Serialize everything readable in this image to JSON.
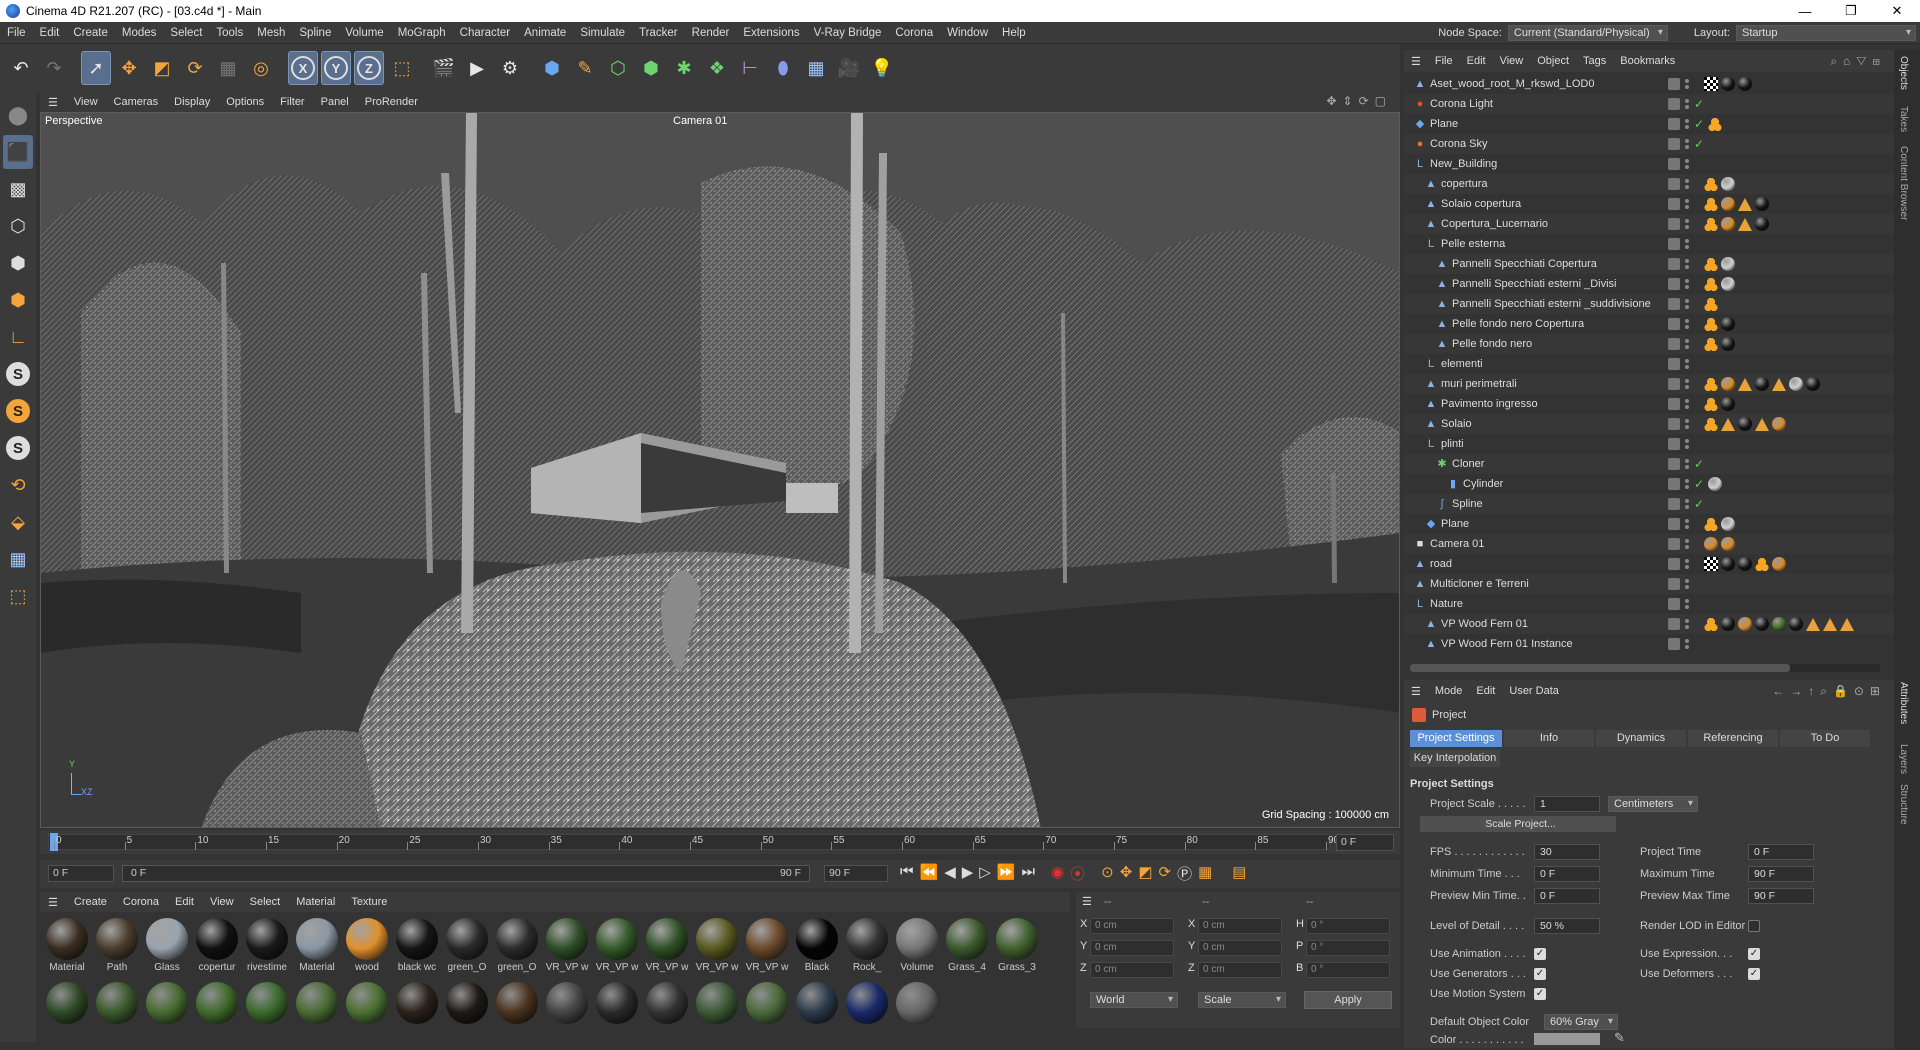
{
  "window": {
    "title": "Cinema 4D R21.207 (RC) - [03.c4d *] - Main",
    "controls": [
      "—",
      "❐",
      "✕"
    ]
  },
  "menubar": {
    "items": [
      "File",
      "Edit",
      "Create",
      "Modes",
      "Select",
      "Tools",
      "Mesh",
      "Spline",
      "Volume",
      "MoGraph",
      "Character",
      "Animate",
      "Simulate",
      "Tracker",
      "Render",
      "Extensions",
      "V-Ray Bridge",
      "Corona",
      "Window",
      "Help"
    ],
    "node_space_label": "Node Space:",
    "node_space_value": "Current (Standard/Physical)",
    "layout_label": "Layout:",
    "layout_value": "Startup"
  },
  "viewport": {
    "menu": [
      "View",
      "Cameras",
      "Display",
      "Options",
      "Filter",
      "Panel",
      "ProRender"
    ],
    "view_name": "Perspective",
    "camera_name": "Camera 01",
    "grid_spacing": "Grid Spacing : 100000 cm",
    "axis_y": "Y",
    "axis_xz": "XZ"
  },
  "timeline": {
    "ticks": [
      "0",
      "5",
      "10",
      "15",
      "20",
      "25",
      "30",
      "35",
      "40",
      "45",
      "50",
      "55",
      "60",
      "65",
      "70",
      "75",
      "80",
      "85",
      "90"
    ],
    "current_frame_field": "0 F",
    "start_field": "0 F",
    "range_start": "0 F",
    "range_end": "90 F",
    "end_field": "90 F"
  },
  "materials": {
    "menu": [
      "Create",
      "Corona",
      "Edit",
      "View",
      "Select",
      "Material",
      "Texture"
    ],
    "row1": [
      {
        "name": "Material",
        "color": "#3a2e22"
      },
      {
        "name": "Path",
        "color": "#4a3d2c"
      },
      {
        "name": "Glass",
        "color": "#9aa4ad"
      },
      {
        "name": "copertur",
        "color": "#111111"
      },
      {
        "name": "rivestime",
        "color": "#1a1a1a"
      },
      {
        "name": "Material",
        "color": "#8c96a3"
      },
      {
        "name": "wood",
        "color": "#e0902e"
      },
      {
        "name": "black wc",
        "color": "#151515"
      },
      {
        "name": "green_O",
        "color": "#2a2a2a"
      },
      {
        "name": "green_O",
        "color": "#2c2c2c"
      },
      {
        "name": "VR_VP w",
        "color": "#2e4f26"
      },
      {
        "name": "VR_VP w",
        "color": "#345a2a"
      },
      {
        "name": "VR_VP w",
        "color": "#2f5226"
      },
      {
        "name": "VR_VP w",
        "color": "#5a5a22"
      },
      {
        "name": "VR_VP w",
        "color": "#6b4a2a"
      },
      {
        "name": "Black",
        "color": "#050505"
      },
      {
        "name": "Rock_",
        "color": "#333333"
      },
      {
        "name": "Volume",
        "color": "#777777"
      },
      {
        "name": "Grass_4",
        "color": "#3c5a2c"
      },
      {
        "name": "Grass_3",
        "color": "#40622e"
      }
    ],
    "row2": [
      "#2e4a26",
      "#3a5a2c",
      "#476b30",
      "#3f6a2c",
      "#3b6a2e",
      "#486b33",
      "#4b7032",
      "#2a221a",
      "#1e1a16",
      "#4a3320",
      "#444444",
      "#2a2a2a",
      "#333333",
      "#3c5a34",
      "#4a6a3a",
      "#2a3a4a",
      "#1a2a6a",
      "#666666"
    ]
  },
  "coords": {
    "header": [
      "--",
      "--",
      "--"
    ],
    "rows": [
      {
        "a1": "X",
        "v1": "0 cm",
        "a2": "X",
        "v2": "0 cm",
        "a3": "H",
        "v3": "0 °"
      },
      {
        "a1": "Y",
        "v1": "0 cm",
        "a2": "Y",
        "v2": "0 cm",
        "a3": "P",
        "v3": "0 °"
      },
      {
        "a1": "Z",
        "v1": "0 cm",
        "a2": "Z",
        "v2": "0 cm",
        "a3": "B",
        "v3": "0 °"
      }
    ],
    "world": "World",
    "scale": "Scale",
    "apply": "Apply"
  },
  "object_manager": {
    "menu": [
      "File",
      "Edit",
      "View",
      "Object",
      "Tags",
      "Bookmarks"
    ],
    "objects": [
      {
        "name": "Aset_wood_root_M_rkswd_LOD0",
        "indent": 0,
        "icon": "polygon-icon",
        "glyph": "▲",
        "color": "#8ab4e8",
        "check": false,
        "tags": [
          "chk",
          "dark",
          "dark"
        ]
      },
      {
        "name": "Corona Light",
        "indent": 0,
        "icon": "light-icon",
        "glyph": "●",
        "color": "#f04a2a",
        "check": true,
        "tags": []
      },
      {
        "name": "Plane",
        "indent": 0,
        "icon": "plane-icon",
        "glyph": "◆",
        "color": "#6ba6f0",
        "check": true,
        "tags": [
          "ph"
        ]
      },
      {
        "name": "Corona Sky",
        "indent": 0,
        "icon": "sky-icon",
        "glyph": "●",
        "color": "#f06a2a",
        "check": true,
        "tags": []
      },
      {
        "name": "New_Building",
        "indent": 0,
        "icon": "null-icon",
        "glyph": "L",
        "color": "#8ab4e8",
        "check": false,
        "tags": []
      },
      {
        "name": "copertura",
        "indent": 1,
        "icon": "polygon-icon",
        "glyph": "▲",
        "color": "#8ab4e8",
        "check": false,
        "tags": [
          "ph",
          "gray"
        ]
      },
      {
        "name": "Solaio copertura",
        "indent": 1,
        "icon": "polygon-icon",
        "glyph": "▲",
        "color": "#8ab4e8",
        "check": false,
        "tags": [
          "ph",
          "orange",
          "tri",
          "dark"
        ]
      },
      {
        "name": "Copertura_Lucernario",
        "indent": 1,
        "icon": "polygon-icon",
        "glyph": "▲",
        "color": "#8ab4e8",
        "check": false,
        "tags": [
          "ph",
          "orange",
          "tri",
          "dark"
        ]
      },
      {
        "name": "Pelle esterna",
        "indent": 1,
        "icon": "null-icon",
        "glyph": "L",
        "color": "#8ab4e8",
        "check": false,
        "tags": []
      },
      {
        "name": "Pannelli Specchiati Copertura",
        "indent": 2,
        "icon": "polygon-icon",
        "glyph": "▲",
        "color": "#8ab4e8",
        "check": false,
        "tags": [
          "ph",
          "gray"
        ]
      },
      {
        "name": "Pannelli Specchiati esterni _Divisi",
        "indent": 2,
        "icon": "polygon-icon",
        "glyph": "▲",
        "color": "#8ab4e8",
        "check": false,
        "tags": [
          "ph",
          "gray"
        ]
      },
      {
        "name": "Pannelli Specchiati esterni _suddivisione",
        "indent": 2,
        "icon": "polygon-icon",
        "glyph": "▲",
        "color": "#8ab4e8",
        "check": false,
        "tags": [
          "ph"
        ]
      },
      {
        "name": "Pelle fondo nero Copertura",
        "indent": 2,
        "icon": "polygon-icon",
        "glyph": "▲",
        "color": "#8ab4e8",
        "check": false,
        "tags": [
          "ph",
          "dark"
        ]
      },
      {
        "name": "Pelle fondo nero",
        "indent": 2,
        "icon": "polygon-icon",
        "glyph": "▲",
        "color": "#8ab4e8",
        "check": false,
        "tags": [
          "ph",
          "dark"
        ]
      },
      {
        "name": "elementi",
        "indent": 1,
        "icon": "null-icon",
        "glyph": "L",
        "color": "#8ab4e8",
        "check": false,
        "tags": []
      },
      {
        "name": "muri perimetrali",
        "indent": 1,
        "icon": "polygon-icon",
        "glyph": "▲",
        "color": "#8ab4e8",
        "check": false,
        "tags": [
          "ph",
          "orange",
          "tri",
          "dark",
          "tri",
          "gray",
          "dark"
        ]
      },
      {
        "name": "Pavimento ingresso",
        "indent": 1,
        "icon": "polygon-icon",
        "glyph": "▲",
        "color": "#8ab4e8",
        "check": false,
        "tags": [
          "ph",
          "dark"
        ]
      },
      {
        "name": "Solaio",
        "indent": 1,
        "icon": "polygon-icon",
        "glyph": "▲",
        "color": "#8ab4e8",
        "check": false,
        "tags": [
          "ph",
          "tri",
          "dark",
          "tri",
          "orange"
        ]
      },
      {
        "name": "plinti",
        "indent": 1,
        "icon": "null-icon",
        "glyph": "L",
        "color": "#8ab4e8",
        "check": false,
        "tags": []
      },
      {
        "name": "Cloner",
        "indent": 2,
        "icon": "cloner-icon",
        "glyph": "✱",
        "color": "#6fd36f",
        "check": true,
        "tags": []
      },
      {
        "name": "Cylinder",
        "indent": 3,
        "icon": "cylinder-icon",
        "glyph": "▮",
        "color": "#6ba6f0",
        "check": true,
        "tags": [
          "gray"
        ]
      },
      {
        "name": "Spline",
        "indent": 2,
        "icon": "spline-icon",
        "glyph": "∫",
        "color": "#6ba6f0",
        "check": true,
        "tags": []
      },
      {
        "name": "Plane",
        "indent": 1,
        "icon": "plane-icon",
        "glyph": "◆",
        "color": "#6ba6f0",
        "check": false,
        "tags": [
          "ph",
          "gray"
        ]
      },
      {
        "name": "Camera 01",
        "indent": 0,
        "icon": "camera-icon",
        "glyph": "■",
        "color": "#dddddd",
        "check": false,
        "tags": [
          "orange",
          "orange"
        ]
      },
      {
        "name": "road",
        "indent": 0,
        "icon": "polygon-icon",
        "glyph": "▲",
        "color": "#8ab4e8",
        "check": false,
        "tags": [
          "chk",
          "dark",
          "dark",
          "ph",
          "orange"
        ]
      },
      {
        "name": "Multicloner e Terreni",
        "indent": 0,
        "icon": "polygon-icon",
        "glyph": "▲",
        "color": "#8ab4e8",
        "check": false,
        "tags": []
      },
      {
        "name": "Nature",
        "indent": 0,
        "icon": "null-icon",
        "glyph": "L",
        "color": "#8ab4e8",
        "check": false,
        "tags": []
      },
      {
        "name": "VP Wood Fern 01",
        "indent": 1,
        "icon": "polygon-icon",
        "glyph": "▲",
        "color": "#8ab4e8",
        "check": false,
        "tags": [
          "ph",
          "dark",
          "orange",
          "dark",
          "green",
          "dark",
          "tri",
          "tri",
          "tri"
        ]
      },
      {
        "name": "VP Wood Fern 01 Instance",
        "indent": 1,
        "icon": "instance-icon",
        "glyph": "▲",
        "color": "#8ab4e8",
        "check": false,
        "tags": []
      }
    ]
  },
  "attribute_manager": {
    "menu": [
      "Mode",
      "Edit",
      "User Data"
    ],
    "object_label": "Project",
    "tabs": [
      "Project Settings",
      "Info",
      "Dynamics",
      "Referencing",
      "To Do"
    ],
    "subtab": "Key Interpolation",
    "section": "Project Settings",
    "project_scale_label": "Project Scale . . . . .",
    "project_scale_value": "1",
    "project_scale_unit": "Centimeters",
    "scale_project_button": "Scale Project...",
    "fps_label": "FPS . . . . . . . . . . . .",
    "fps_value": "30",
    "project_time_label": "Project Time",
    "project_time_value": "0 F",
    "min_time_label": "Minimum Time . . .",
    "min_time_value": "0 F",
    "max_time_label": "Maximum Time",
    "max_time_value": "90 F",
    "preview_min_label": "Preview Min Time. .",
    "preview_min_value": "0 F",
    "preview_max_label": "Preview Max Time",
    "preview_max_value": "90 F",
    "lod_label": "Level of Detail . . . .",
    "lod_value": "50 %",
    "render_lod_label": "Render LOD in Editor",
    "use_animation_label": "Use Animation . . . .",
    "use_expression_label": "Use Expression. . .",
    "use_generators_label": "Use Generators . . .",
    "use_deformers_label": "Use Deformers . . .",
    "use_motion_label": "Use Motion System",
    "default_color_label": "Default Object Color",
    "default_color_value": "60% Gray",
    "color_label": "Color . . . . . . . . . . ."
  },
  "side_tabs": {
    "top": [
      "Objects",
      "Takes",
      "Content Browser"
    ],
    "bottom": [
      "Attributes",
      "Layers",
      "Structure"
    ]
  }
}
